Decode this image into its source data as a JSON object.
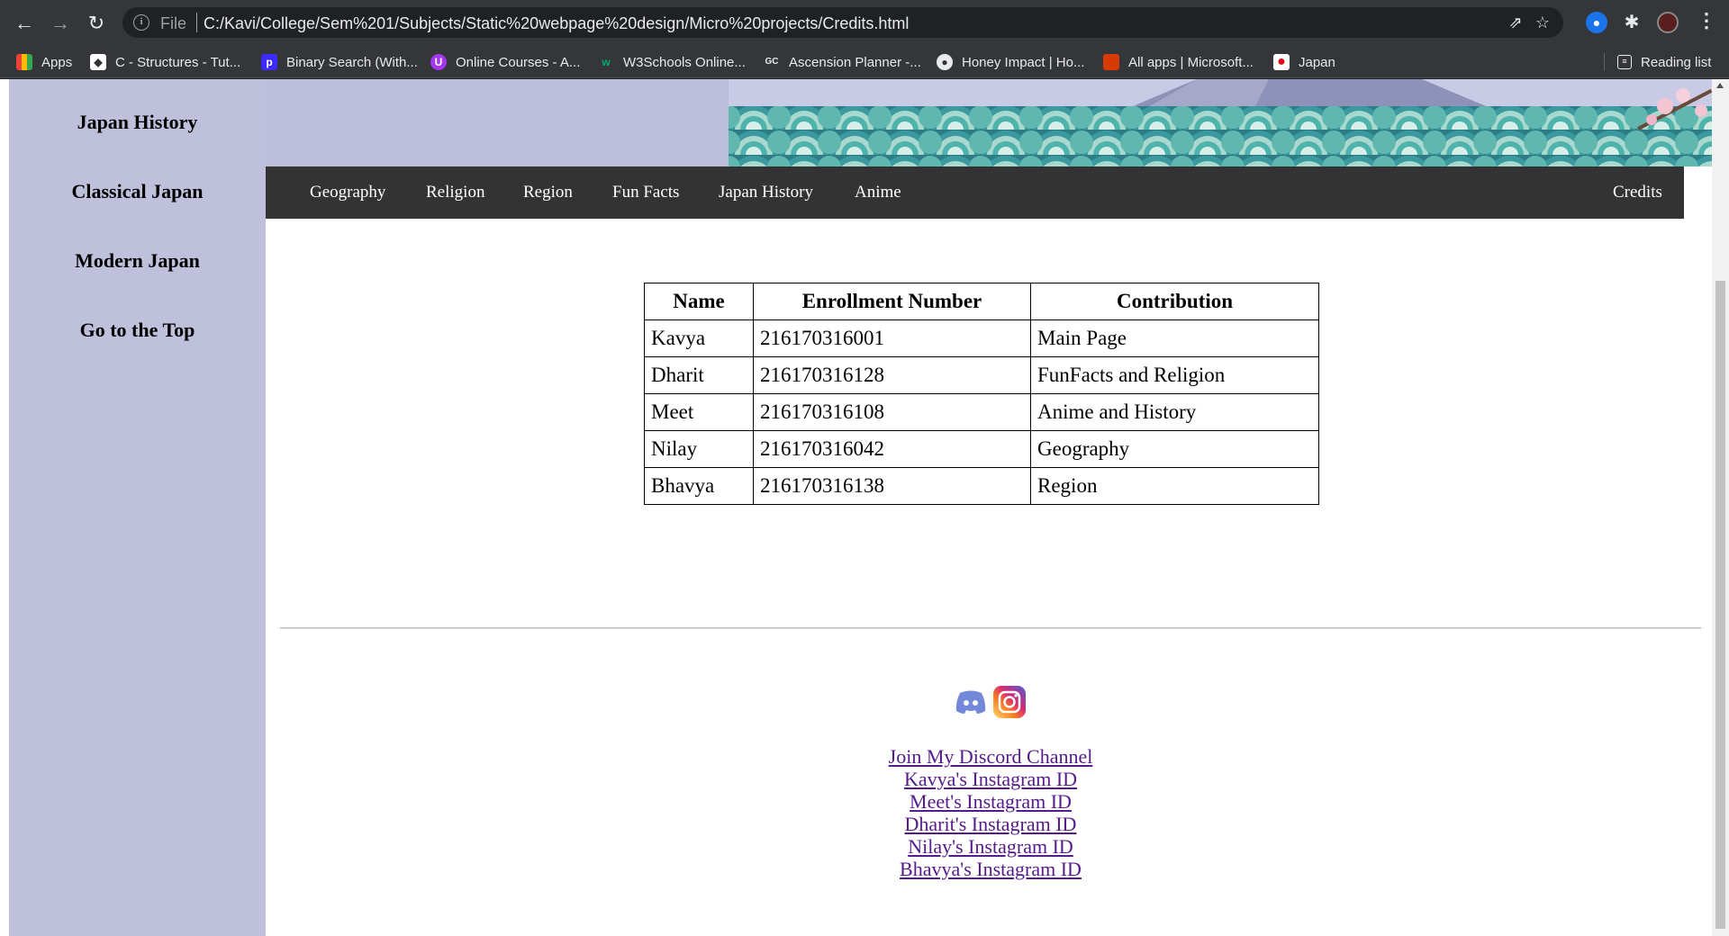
{
  "browser": {
    "scheme_label": "File",
    "url": "C:/Kavi/College/Sem%201/Subjects/Static%20webpage%20design/Micro%20projects/Credits.html",
    "bookmarks": [
      {
        "label": "Apps",
        "icon": "apps-grid-icon"
      },
      {
        "label": "C - Structures - Tut...",
        "icon": "tutorial-site-icon"
      },
      {
        "label": "Binary Search (With...",
        "icon": "programiz-icon"
      },
      {
        "label": "Online Courses - A...",
        "icon": "udemy-icon"
      },
      {
        "label": "W3Schools Online...",
        "icon": "w3schools-icon"
      },
      {
        "label": "Ascension Planner -...",
        "icon": "genshin-center-icon"
      },
      {
        "label": "Honey Impact | Ho...",
        "icon": "honey-impact-icon"
      },
      {
        "label": "All apps | Microsoft...",
        "icon": "microsoft-office-icon"
      },
      {
        "label": "Japan",
        "icon": "japan-flag-icon"
      }
    ],
    "reading_list": "Reading list"
  },
  "sidebar": {
    "items": [
      "Japan History",
      "Classical Japan",
      "Modern Japan",
      "Go to the Top"
    ]
  },
  "topnav": {
    "links": [
      "Geography",
      "Religion",
      "Region",
      "Fun Facts",
      "Japan History",
      "Anime"
    ],
    "right_link": "Credits"
  },
  "credits_table": {
    "headers": [
      "Name",
      "Enrollment Number",
      "Contribution"
    ],
    "rows": [
      [
        "Kavya",
        "216170316001",
        "Main Page"
      ],
      [
        "Dharit",
        "216170316128",
        "FunFacts and Religion"
      ],
      [
        "Meet",
        "216170316108",
        "Anime and History"
      ],
      [
        "Nilay",
        "216170316042",
        "Geography"
      ],
      [
        "Bhavya",
        "216170316138",
        "Region"
      ]
    ]
  },
  "footer": {
    "icons": [
      "discord-icon",
      "instagram-icon"
    ],
    "links": [
      "Join My Discord Channel",
      "Kavya's Instagram ID",
      "Meet's Instagram ID",
      "Dharit's Instagram ID",
      "Nilay's Instagram ID",
      "Bhavya's Instagram ID"
    ]
  },
  "colors": {
    "sidebar_bg": "#bfc0dc",
    "nav_bg": "#333333",
    "link_visited": "#551a8b",
    "discord": "#7289da"
  }
}
